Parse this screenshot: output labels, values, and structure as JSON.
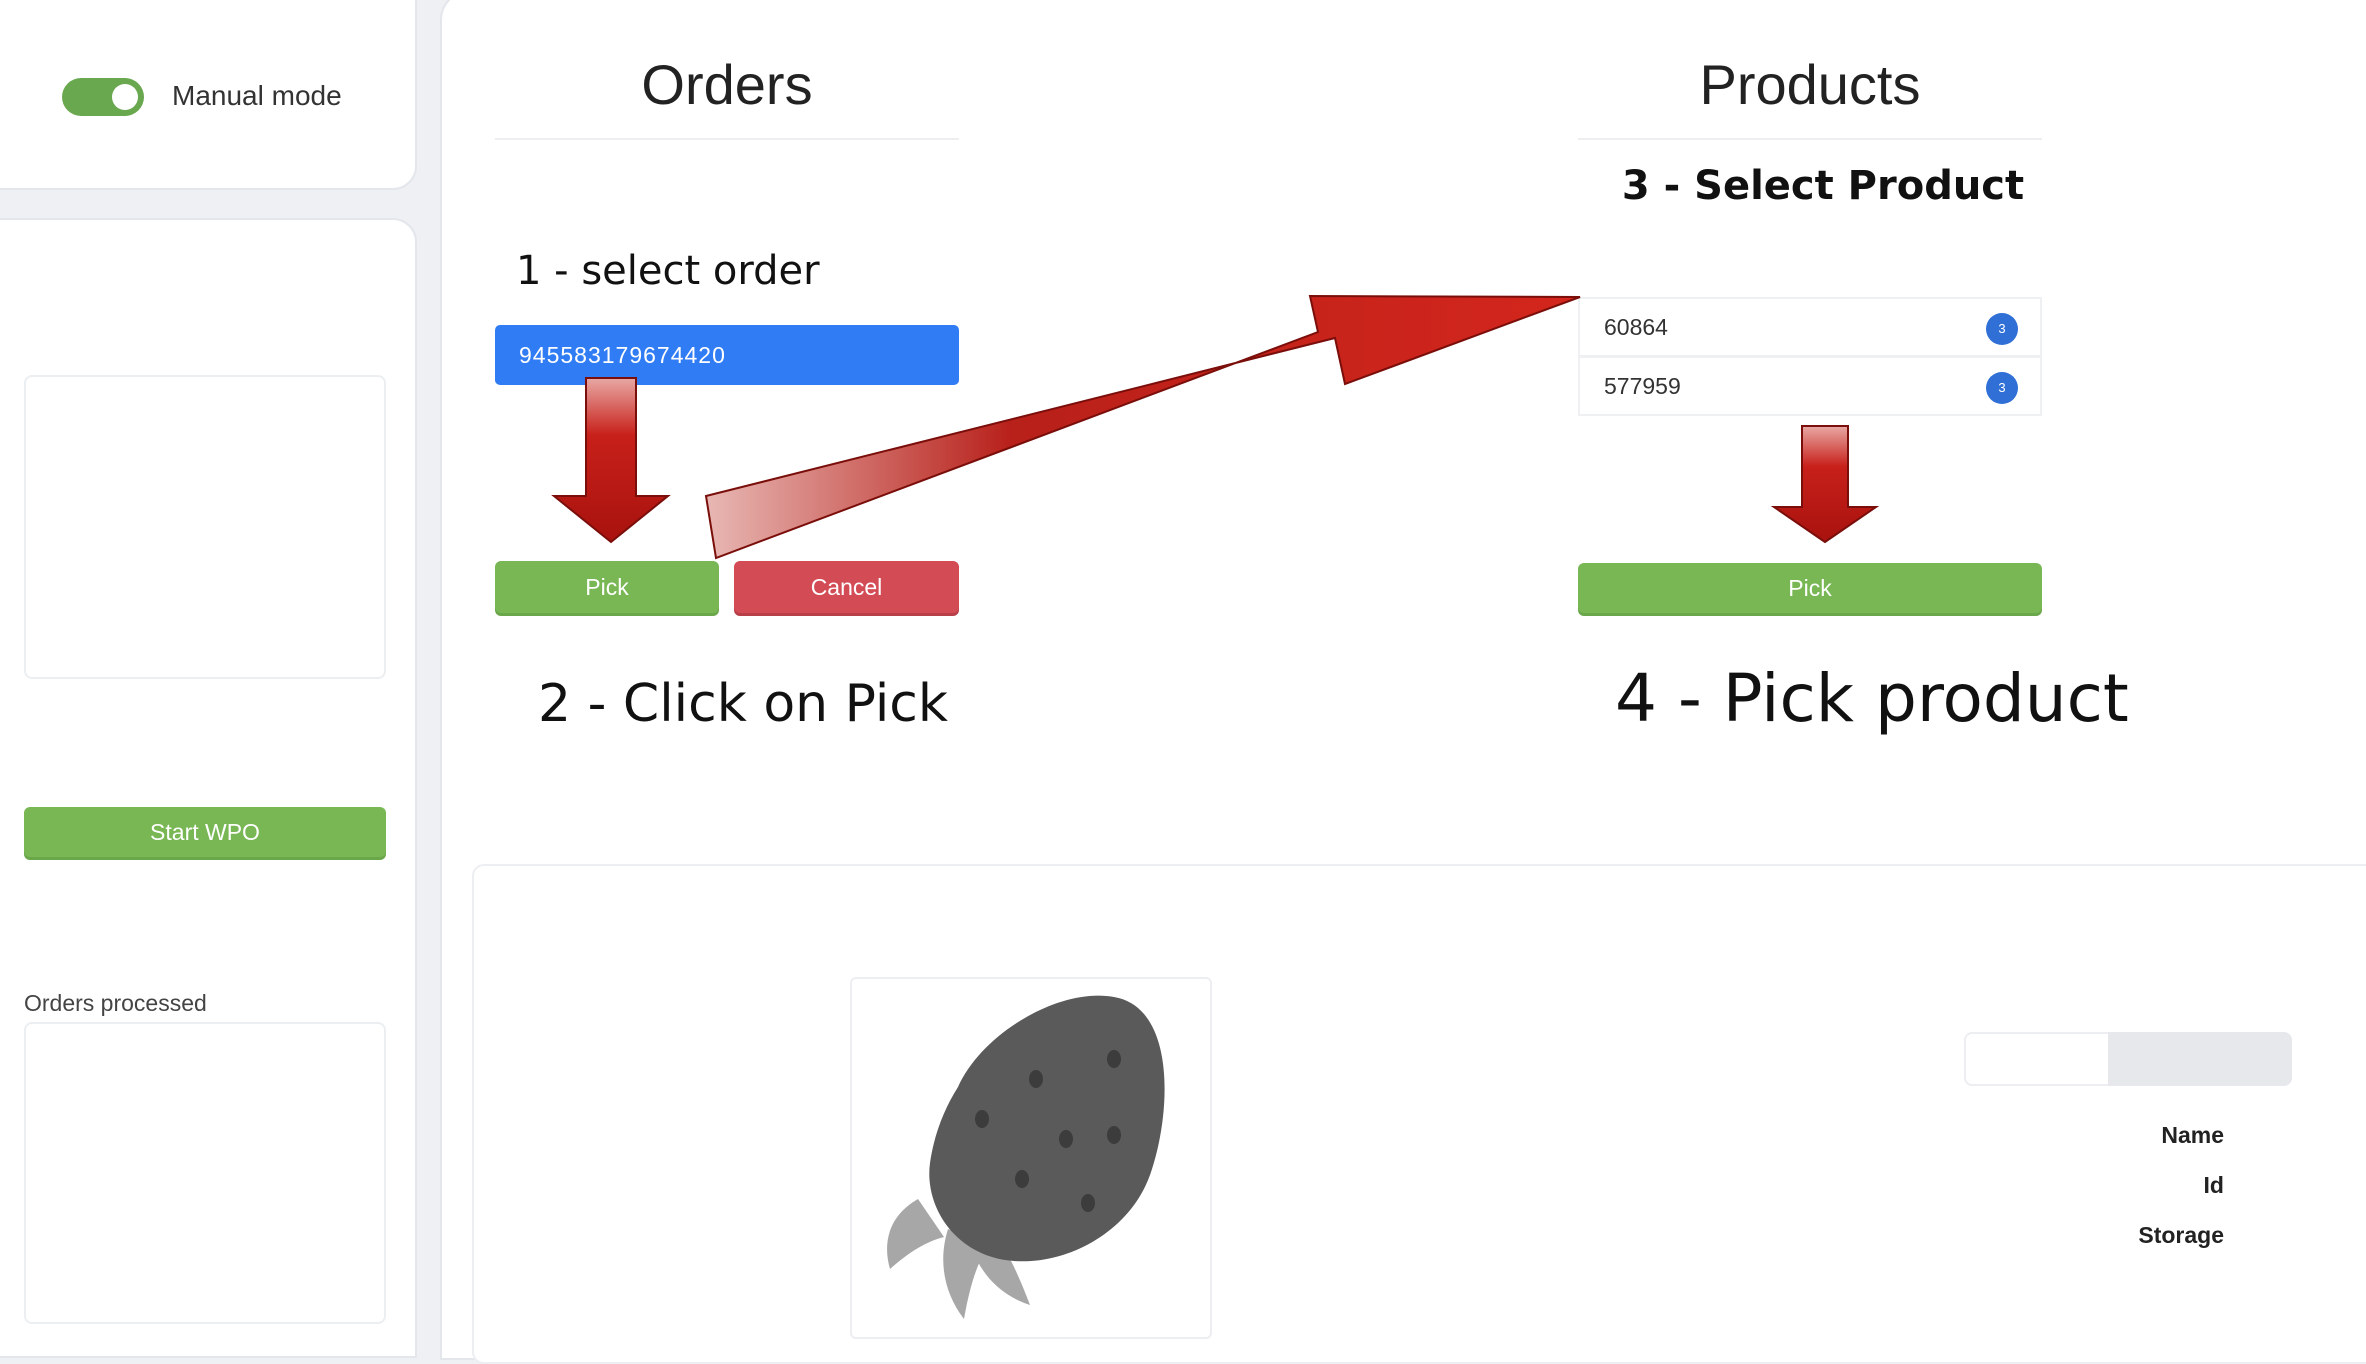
{
  "sidebar": {
    "mode_label": "Manual mode",
    "mode_on": true,
    "start_button": "Start WPO",
    "orders_processed_label": "Orders processed"
  },
  "orders": {
    "heading": "Orders",
    "step1": "1 - select order",
    "selected_order": "945583179674420",
    "pick_label": "Pick",
    "cancel_label": "Cancel",
    "step2": "2 - Click on Pick"
  },
  "products": {
    "heading": "Products",
    "step3": "3 - Select Product",
    "items": [
      {
        "id": "60864",
        "count": "3"
      },
      {
        "id": "577959",
        "count": "3"
      }
    ],
    "pick_label": "Pick",
    "step4": "4 - Pick product"
  },
  "details": {
    "fields": [
      "Name",
      "Id",
      "Storage"
    ]
  },
  "colors": {
    "green": "#78b754",
    "red": "#d24b55",
    "blue": "#2f7cf4",
    "arrow_red": "#c91a14"
  }
}
